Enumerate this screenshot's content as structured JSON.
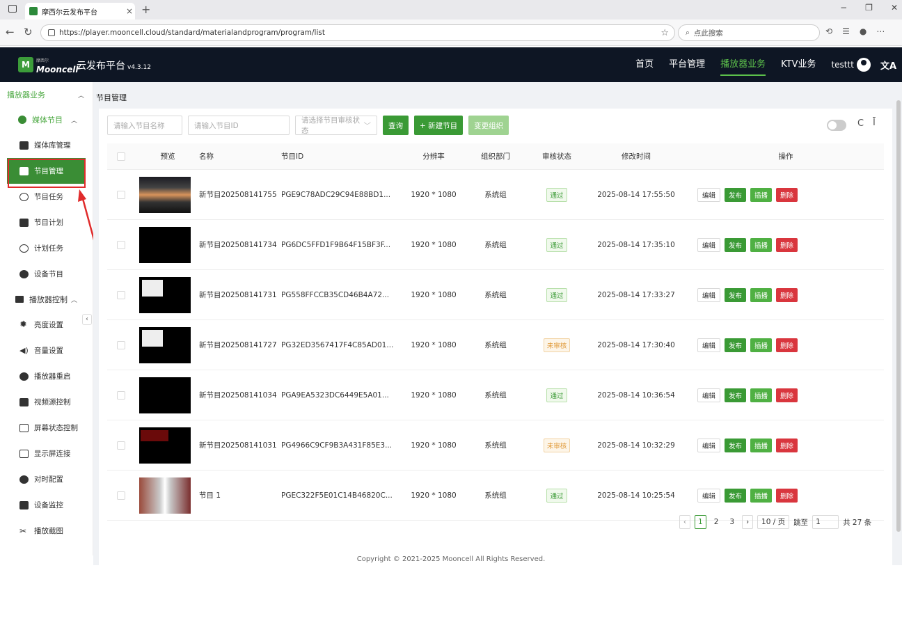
{
  "browser": {
    "tab_title": "摩西尔云发布平台",
    "url": "https://player.mooncell.cloud/standard/materialandprogram/program/list",
    "search_placeholder": "点此搜索"
  },
  "app": {
    "logo_small": "摩西尔",
    "logo_brand": "Mooncell",
    "title": "云发布平台",
    "version": "v4.3.12",
    "nav": [
      {
        "label": "首页"
      },
      {
        "label": "平台管理"
      },
      {
        "label": "播放器业务"
      },
      {
        "label": "KTV业务"
      }
    ],
    "user": "testtt"
  },
  "sidebar": {
    "group": "播放器业务",
    "media_section": "媒体节目",
    "media_items": [
      {
        "label": "媒体库管理"
      },
      {
        "label": "节目管理"
      },
      {
        "label": "节目任务"
      },
      {
        "label": "节目计划"
      },
      {
        "label": "计划任务"
      },
      {
        "label": "设备节目"
      }
    ],
    "control_section": "播放器控制",
    "control_items": [
      {
        "label": "亮度设置"
      },
      {
        "label": "音量设置"
      },
      {
        "label": "播放器重启"
      },
      {
        "label": "视频源控制"
      },
      {
        "label": "屏幕状态控制"
      },
      {
        "label": "显示屏连接"
      },
      {
        "label": "对时配置"
      },
      {
        "label": "设备监控"
      },
      {
        "label": "播放截图"
      }
    ]
  },
  "page": {
    "breadcrumb": "节目管理",
    "filters": {
      "name_placeholder": "请输入节目名称",
      "id_placeholder": "请输入节目ID",
      "status_placeholder": "请选择节目审核状态"
    },
    "buttons": {
      "query": "查询",
      "new_program": "+ 新建节目",
      "change_org": "变更组织"
    },
    "columns": [
      "预览",
      "名称",
      "节目ID",
      "分辨率",
      "组织部门",
      "审核状态",
      "修改时间",
      "操作"
    ],
    "rows": [
      {
        "name": "新节目202508141755",
        "id": "PGE9C78ADC29C94E88BD1...",
        "res": "1920 * 1080",
        "dept": "系统组",
        "status": "通过",
        "time": "2025-08-14 17:55:50"
      },
      {
        "name": "新节目202508141734",
        "id": "PG6DC5FFD1F9B64F15BF3F...",
        "res": "1920 * 1080",
        "dept": "系统组",
        "status": "通过",
        "time": "2025-08-14 17:35:10"
      },
      {
        "name": "新节目202508141731",
        "id": "PG558FFCCB35CD46B4A72...",
        "res": "1920 * 1080",
        "dept": "系统组",
        "status": "通过",
        "time": "2025-08-14 17:33:27"
      },
      {
        "name": "新节目202508141727",
        "id": "PG32ED3567417F4C85AD01...",
        "res": "1920 * 1080",
        "dept": "系统组",
        "status": "未审核",
        "time": "2025-08-14 17:30:40"
      },
      {
        "name": "新节目202508141034",
        "id": "PGA9EA5323DC6449E5A01...",
        "res": "1920 * 1080",
        "dept": "系统组",
        "status": "通过",
        "time": "2025-08-14 10:36:54"
      },
      {
        "name": "新节目202508141031",
        "id": "PG4966C9CF9B3A431F85E3...",
        "res": "1920 * 1080",
        "dept": "系统组",
        "status": "未审核",
        "time": "2025-08-14 10:32:29"
      },
      {
        "name": "节目 1",
        "id": "PGEC322F5E01C14B46820C...",
        "res": "1920 * 1080",
        "dept": "系统组",
        "status": "通过",
        "time": "2025-08-14 10:25:54"
      }
    ],
    "ops": {
      "edit": "编辑",
      "publish": "发布",
      "insert": "插播",
      "delete": "删除"
    },
    "pagination": {
      "pages": [
        "1",
        "2",
        "3"
      ],
      "page_size": "10 / 页",
      "jump_label": "跳至",
      "jump_value": "1",
      "total": "共 27 条"
    }
  },
  "footer": "Copyright © 2021-2025 Mooncell All Rights Reserved."
}
